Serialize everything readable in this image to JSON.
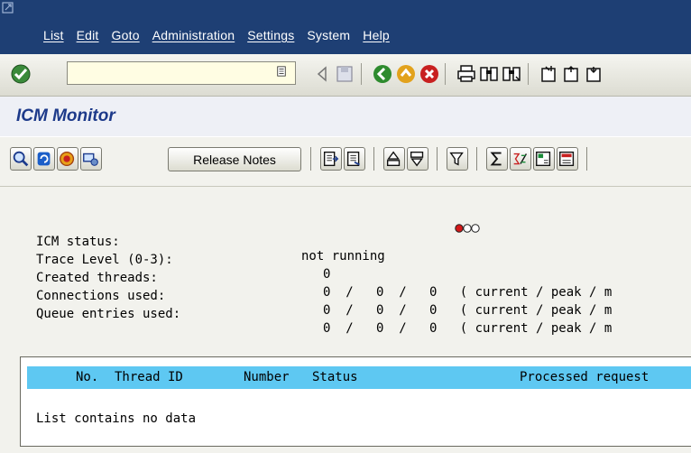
{
  "menu": [
    "List",
    "Edit",
    "Goto",
    "Administration",
    "Settings",
    "System",
    "Help"
  ],
  "command_field": {
    "value": ""
  },
  "screen_title": "ICM Monitor",
  "app_toolbar": {
    "release_notes": "Release Notes"
  },
  "status": [
    {
      "label": "ICM status:",
      "value": "not running"
    },
    {
      "label": "Trace Level (0-3):",
      "value": "0"
    },
    {
      "label": "Created threads:",
      "value": "0  /   0  /   0   ( current / peak / m"
    },
    {
      "label": "Connections used:",
      "value": "0  /   0  /   0   ( current / peak / m"
    },
    {
      "label": "Queue entries used:",
      "value": "0  /   0  /   0   ( current / peak / m"
    }
  ],
  "traffic_light": {
    "state": "red",
    "colors": [
      "#d41818",
      "#ffffff",
      "#ffffff"
    ]
  },
  "table": {
    "columns": [
      "No.",
      "Thread ID",
      "Number",
      "Status",
      "Processed request"
    ],
    "empty_message": "List contains no data"
  },
  "colors": {
    "menubar": "#1e3f74",
    "header": "#5ec8f2",
    "title": "#1d3a8a"
  }
}
